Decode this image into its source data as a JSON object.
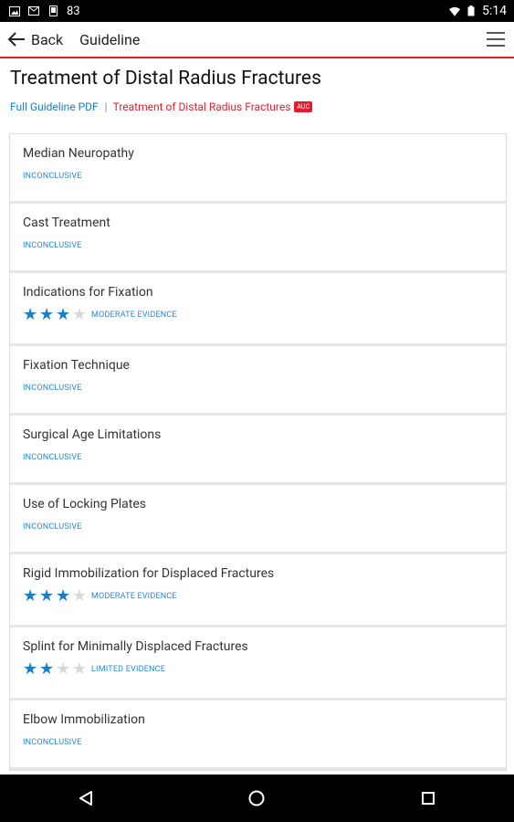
{
  "status": {
    "left_number": "83",
    "time": "5:14"
  },
  "appbar": {
    "back_label": "Back",
    "title": "Guideline"
  },
  "page": {
    "title": "Treatment of Distal Radius Fractures",
    "link_pdf": "Full Guideline PDF",
    "separator": "|",
    "link_auc": "Treatment of Distal Radius Fractures",
    "badge": "AUC"
  },
  "items": [
    {
      "title": "Median Neuropathy",
      "evidence": "INCONCLUSIVE",
      "stars": 0
    },
    {
      "title": "Cast Treatment",
      "evidence": "INCONCLUSIVE",
      "stars": 0
    },
    {
      "title": "Indications for Fixation",
      "evidence": "MODERATE EVIDENCE",
      "stars": 3
    },
    {
      "title": "Fixation Technique",
      "evidence": "INCONCLUSIVE",
      "stars": 0
    },
    {
      "title": "Surgical Age Limitations",
      "evidence": "INCONCLUSIVE",
      "stars": 0
    },
    {
      "title": "Use of Locking Plates",
      "evidence": "INCONCLUSIVE",
      "stars": 0
    },
    {
      "title": "Rigid Immobilization for Displaced Fractures",
      "evidence": "MODERATE EVIDENCE",
      "stars": 3
    },
    {
      "title": "Splint for Minimally Displaced Fractures",
      "evidence": "LIMITED EVIDENCE",
      "stars": 2
    },
    {
      "title": "Elbow Immobilization",
      "evidence": "INCONCLUSIVE",
      "stars": 0
    }
  ],
  "colors": {
    "accent_red": "#e21d2c",
    "link_blue": "#1b7fc4",
    "evidence_blue": "#2a8ad0"
  }
}
